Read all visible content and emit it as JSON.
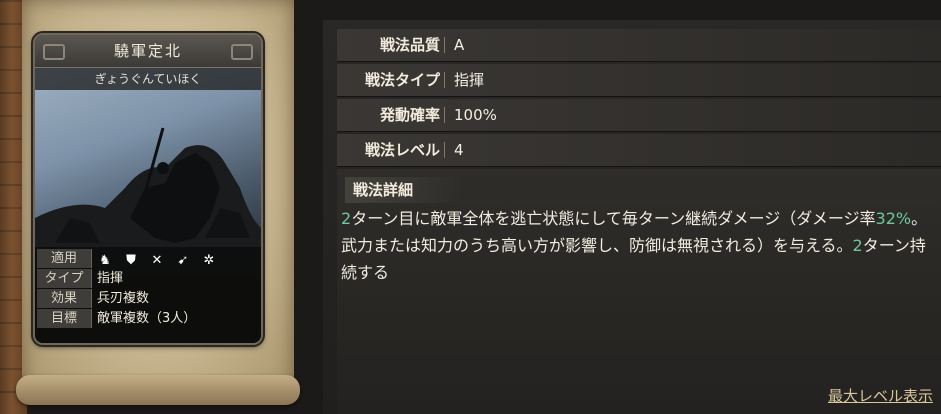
{
  "card": {
    "name": "驍軍定北",
    "reading": "ぎょうぐんていほく",
    "stats": [
      {
        "key": "適用",
        "icons": [
          "horse-icon",
          "shield-icon",
          "bow-icon",
          "spear-icon",
          "wheel-icon"
        ]
      },
      {
        "key": "タイプ",
        "value": "指揮"
      },
      {
        "key": "効果",
        "value": "兵刃複数"
      },
      {
        "key": "目標",
        "value": "敵軍複数（3人）"
      }
    ]
  },
  "properties": [
    {
      "key": "戦法品質",
      "value": "A"
    },
    {
      "key": "戦法タイプ",
      "value": "指揮"
    },
    {
      "key": "発動確率",
      "value": "100%"
    },
    {
      "key": "戦法レベル",
      "value": "4"
    }
  ],
  "detail": {
    "heading": "戦法詳細",
    "segments": [
      {
        "text": "2",
        "highlight": true
      },
      {
        "text": "ターン目に敵軍全体を逃亡状態にして毎ターン継続ダメージ（ダメージ率",
        "highlight": false
      },
      {
        "text": "32%",
        "highlight": true
      },
      {
        "text": "。武力または知力のうち高い方が影響し、防御は無視される）を与える。",
        "highlight": false
      },
      {
        "text": "2",
        "highlight": true
      },
      {
        "text": "ターン持続する",
        "highlight": false
      }
    ]
  },
  "max_level_link": "最大レベル表示",
  "colors": {
    "highlight": "#6fc79a",
    "link": "#d8c79c"
  }
}
